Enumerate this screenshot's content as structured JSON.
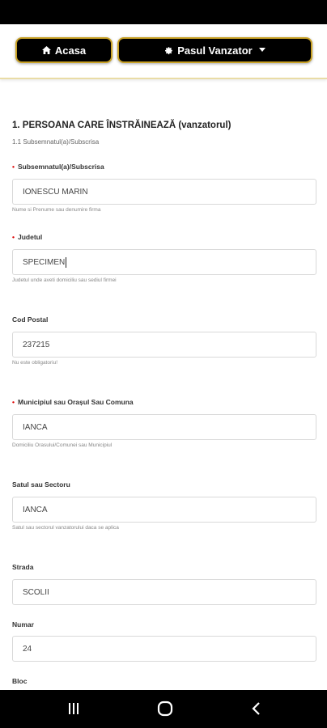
{
  "nav": {
    "home_label": "Acasa",
    "step_label": "Pasul Vanzator",
    "home_icon": "home-icon",
    "step_icon": "gear-icon"
  },
  "section": {
    "title": "1. PERSOANA CARE ÎNSTRĂINEAZĂ (vanzatorul)",
    "subtitle": "1.1 Subsemnatul(a)/Subscrisa"
  },
  "fields": [
    {
      "label": "Subsemnatul(a)/Subscrisa",
      "required": true,
      "value": "IONESCU MARIN",
      "help": "Nume si Prenume sau denumire firma"
    },
    {
      "label": "Judetul",
      "required": true,
      "value": "SPECIMEN",
      "help": "Judetul unde aveti domiciliu sau sediul firmei"
    },
    {
      "label": "Cod Postal",
      "required": false,
      "value": "237215",
      "help": "Nu este obligatoriu!"
    },
    {
      "label": "Municipiul sau Orașul Sau Comuna",
      "required": true,
      "value": "IANCA",
      "help": "Domiciliu Orasului/Comunei sau Municipiul"
    },
    {
      "label": "Satul sau Sectoru",
      "required": false,
      "value": "IANCA",
      "help": "Satul sau sectorul vanzatorului daca se aplica"
    },
    {
      "label": "Strada",
      "required": false,
      "value": "SCOLII",
      "help": ""
    },
    {
      "label": "Numar",
      "required": false,
      "value": "24",
      "help": ""
    },
    {
      "label": "Bloc",
      "required": false,
      "value": "",
      "help": ""
    }
  ],
  "colors": {
    "button_bg": "#000000",
    "button_border": "#c9a227",
    "required_marker": "#dd0000"
  },
  "system_nav": {
    "recent_icon": "recent-apps-icon",
    "home_icon": "home-circle-icon",
    "back_icon": "back-icon"
  }
}
